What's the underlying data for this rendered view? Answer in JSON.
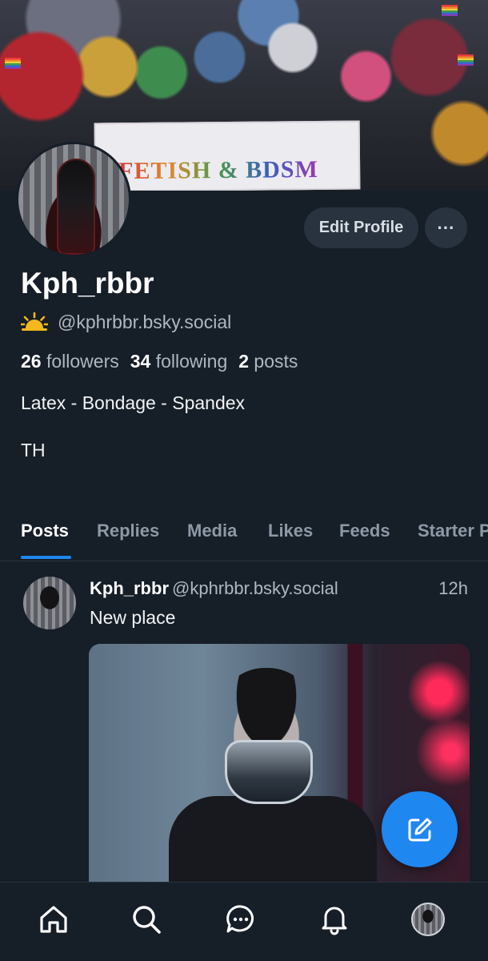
{
  "banner": {
    "sign_text": "FETISH & BDSM"
  },
  "profile": {
    "display_name": "Kph_rbbr",
    "handle": "@kphrbbr.bsky.social",
    "followers_count": "26",
    "followers_label": "followers",
    "following_count": "34",
    "following_label": "following",
    "posts_count": "2",
    "posts_label": "posts",
    "bio_line1": "Latex - Bondage - Spandex",
    "bio_line2": "TH"
  },
  "actions": {
    "edit_label": "Edit Profile",
    "more_label": "···"
  },
  "tabs": [
    {
      "label": "Posts",
      "active": true
    },
    {
      "label": "Replies",
      "active": false
    },
    {
      "label": "Media",
      "active": false
    },
    {
      "label": "Likes",
      "active": false
    },
    {
      "label": "Feeds",
      "active": false
    },
    {
      "label": "Starter Packs",
      "active": false
    }
  ],
  "post": {
    "author_name": "Kph_rbbr",
    "author_handle": "@kphrbbr.bsky.social",
    "time": "12h",
    "text": "New place"
  },
  "icons": {
    "handle_badge": "sunrise-icon",
    "fab": "compose-icon",
    "nav": [
      "home-icon",
      "search-icon",
      "chat-icon",
      "bell-icon",
      "profile-avatar"
    ]
  },
  "colors": {
    "background": "#161e27",
    "accent": "#1f87f0",
    "button_bg": "#28333f",
    "muted_text": "#aeb7c2",
    "sun_yellow": "#f5b81c"
  }
}
